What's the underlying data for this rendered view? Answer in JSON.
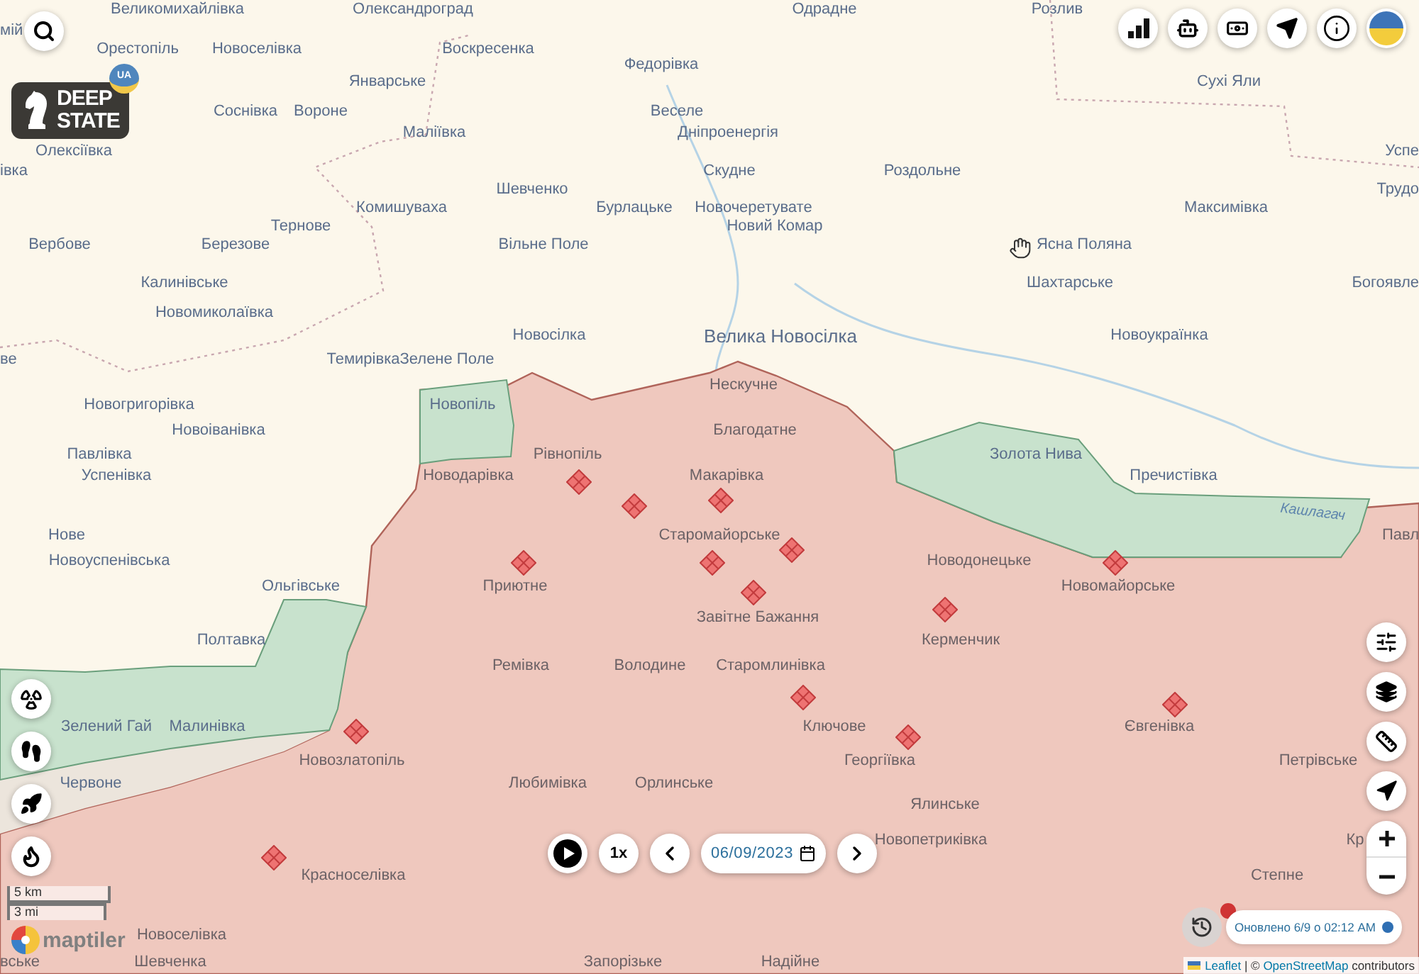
{
  "logo": {
    "lines": [
      "DEEP",
      "STATE"
    ],
    "badge": "UA"
  },
  "places": [
    {
      "name": "Великомихайлівка",
      "kind": "village"
    },
    {
      "name": "Олександроград",
      "kind": "village"
    },
    {
      "name": "Одрадне",
      "kind": "village"
    },
    {
      "name": "Розлив",
      "kind": "village"
    },
    {
      "name": "мій",
      "kind": "village"
    },
    {
      "name": "Орестопіль",
      "kind": "village"
    },
    {
      "name": "Новоселівка",
      "kind": "village"
    },
    {
      "name": "Воскресенка",
      "kind": "village"
    },
    {
      "name": "Федорівка",
      "kind": "village"
    },
    {
      "name": "Январське",
      "kind": "village"
    },
    {
      "name": "Сухі Яли",
      "kind": "village"
    },
    {
      "name": "Соснівка",
      "kind": "village"
    },
    {
      "name": "Вороне",
      "kind": "village"
    },
    {
      "name": "Веселе",
      "kind": "village"
    },
    {
      "name": "Маліївка",
      "kind": "village"
    },
    {
      "name": "Дніпроенергія",
      "kind": "village"
    },
    {
      "name": "Олексіївка",
      "kind": "village"
    },
    {
      "name": "Успе",
      "kind": "village"
    },
    {
      "name": "івка",
      "kind": "village"
    },
    {
      "name": "Скудне",
      "kind": "village"
    },
    {
      "name": "Роздольне",
      "kind": "village"
    },
    {
      "name": "Шевченко",
      "kind": "village"
    },
    {
      "name": "Трудо",
      "kind": "village"
    },
    {
      "name": "Комишуваха",
      "kind": "village"
    },
    {
      "name": "Бурлацьке",
      "kind": "village"
    },
    {
      "name": "Новочеретувате",
      "kind": "village"
    },
    {
      "name": "Максимівка",
      "kind": "village"
    },
    {
      "name": "Тернове",
      "kind": "village"
    },
    {
      "name": "Новий Комар",
      "kind": "village"
    },
    {
      "name": "Вербове",
      "kind": "village"
    },
    {
      "name": "Березове",
      "kind": "village"
    },
    {
      "name": "Вільне Поле",
      "kind": "village"
    },
    {
      "name": "Ясна Поляна",
      "kind": "village"
    },
    {
      "name": "Калинівське",
      "kind": "village"
    },
    {
      "name": "Шахтарське",
      "kind": "village"
    },
    {
      "name": "Богоявле",
      "kind": "village"
    },
    {
      "name": "Новомиколаївка",
      "kind": "village"
    },
    {
      "name": "Новосілка",
      "kind": "village"
    },
    {
      "name": "Велика Новосілка",
      "kind": "town"
    },
    {
      "name": "Новоукраїнка",
      "kind": "village"
    },
    {
      "name": "ве",
      "kind": "village"
    },
    {
      "name": "Темирівка",
      "kind": "village"
    },
    {
      "name": "Зелене Поле",
      "kind": "village"
    },
    {
      "name": "Нескучне",
      "kind": "village"
    },
    {
      "name": "Новогригорівка",
      "kind": "village"
    },
    {
      "name": "Новопіль",
      "kind": "village"
    },
    {
      "name": "Новоіванівка",
      "kind": "village"
    },
    {
      "name": "Благодатне",
      "kind": "village"
    },
    {
      "name": "Павлівка",
      "kind": "village"
    },
    {
      "name": "Рівнопіль",
      "kind": "village"
    },
    {
      "name": "Золота Нива",
      "kind": "village"
    },
    {
      "name": "Успенівка",
      "kind": "village"
    },
    {
      "name": "Новодарівка",
      "kind": "village"
    },
    {
      "name": "Макарівка",
      "kind": "village"
    },
    {
      "name": "Пречистівка",
      "kind": "village"
    },
    {
      "name": "Кашлагач",
      "kind": "river"
    },
    {
      "name": "Нове",
      "kind": "village"
    },
    {
      "name": "Старомайорське",
      "kind": "village"
    },
    {
      "name": "Павл",
      "kind": "village"
    },
    {
      "name": "Новоуспенівська",
      "kind": "village"
    },
    {
      "name": "Новодонецьке",
      "kind": "village"
    },
    {
      "name": "Ольгівське",
      "kind": "village"
    },
    {
      "name": "Приютне",
      "kind": "village"
    },
    {
      "name": "Новомайорське",
      "kind": "village"
    },
    {
      "name": "Завітне Бажання",
      "kind": "village"
    },
    {
      "name": "Полтавка",
      "kind": "village"
    },
    {
      "name": "Керменчик",
      "kind": "village"
    },
    {
      "name": "Ремівка",
      "kind": "village"
    },
    {
      "name": "Володине",
      "kind": "village"
    },
    {
      "name": "Старомлинівка",
      "kind": "village"
    },
    {
      "name": "Зелений Гай",
      "kind": "village"
    },
    {
      "name": "Малинівка",
      "kind": "village"
    },
    {
      "name": "Ключове",
      "kind": "village"
    },
    {
      "name": "Євгенівка",
      "kind": "village"
    },
    {
      "name": "Новозлатопіль",
      "kind": "village"
    },
    {
      "name": "Георгіївка",
      "kind": "village"
    },
    {
      "name": "Петрівське",
      "kind": "village"
    },
    {
      "name": "Червоне",
      "kind": "village"
    },
    {
      "name": "Любимівка",
      "kind": "village"
    },
    {
      "name": "Орлинське",
      "kind": "village"
    },
    {
      "name": "Ялинське",
      "kind": "village"
    },
    {
      "name": "Новопетриківка",
      "kind": "village"
    },
    {
      "name": "Кр",
      "kind": "village"
    },
    {
      "name": "Красноселівка",
      "kind": "village"
    },
    {
      "name": "Степне",
      "kind": "village"
    },
    {
      "name": "Новоселівка",
      "kind": "village"
    },
    {
      "name": "вське",
      "kind": "village"
    },
    {
      "name": "Шевченка",
      "kind": "village"
    },
    {
      "name": "Запорізьке",
      "kind": "village"
    },
    {
      "name": "Надійне",
      "kind": "village"
    }
  ],
  "timeline": {
    "speed": "1x",
    "date": "06/09/2023"
  },
  "status": {
    "text": "Оновлено 6/9 о 02:12 AM"
  },
  "scale": [
    "5 km",
    "3 mi"
  ],
  "maptiler": "maptiler",
  "attribution": [
    {
      "kind": "link",
      "text": "Leaflet"
    },
    {
      "kind": "text",
      "text": "| ©"
    },
    {
      "kind": "link",
      "text": "OpenStreetMap"
    },
    {
      "kind": "text",
      "text": "contributors"
    }
  ]
}
